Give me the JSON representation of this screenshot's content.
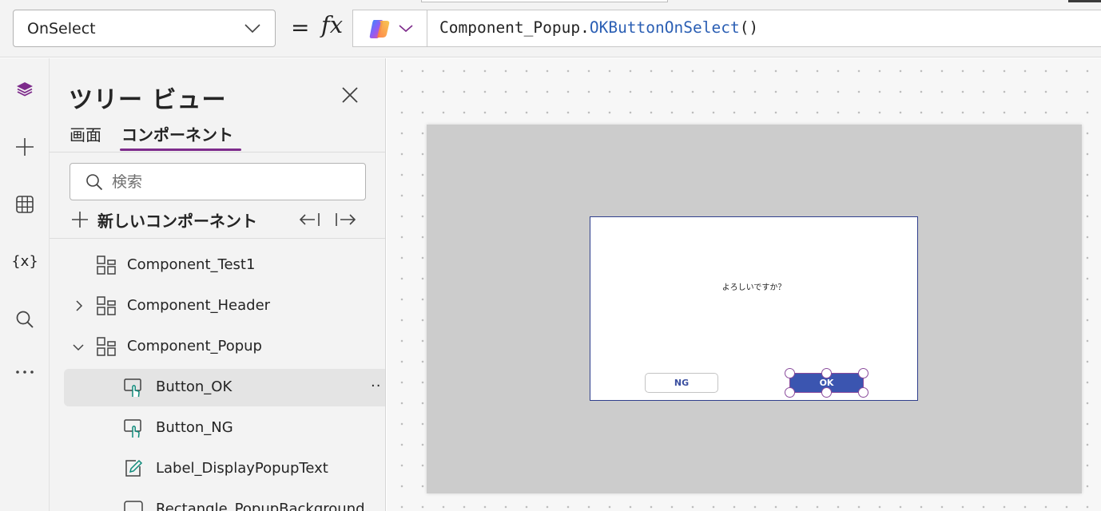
{
  "formula_bar": {
    "property": "OnSelect",
    "equals": "=",
    "fx": "fx",
    "formula_object": "Component_Popup.",
    "formula_function": "OKButtonOnSelect",
    "formula_args": "()"
  },
  "rail": {
    "items": [
      {
        "name": "layers-icon"
      },
      {
        "name": "plus-icon"
      },
      {
        "name": "table-icon"
      },
      {
        "name": "variables-icon",
        "text": "{x}"
      },
      {
        "name": "search-icon"
      },
      {
        "name": "more-icon",
        "text": "•••"
      }
    ],
    "accent": "#7d2b8b"
  },
  "tree": {
    "title": "ツリー ビュー",
    "tabs": [
      {
        "label": "画面"
      },
      {
        "label": "コンポーネント",
        "active": true
      }
    ],
    "search_placeholder": "検索",
    "new_component_label": "新しいコンポーネント",
    "items": [
      {
        "label": "Component_Test1",
        "icon": "component-icon",
        "chevron": "none"
      },
      {
        "label": "Component_Header",
        "icon": "component-icon",
        "chevron": "right"
      },
      {
        "label": "Component_Popup",
        "icon": "component-icon",
        "chevron": "down"
      },
      {
        "label": "Button_OK",
        "icon": "button-icon",
        "selected": true,
        "more": "··"
      },
      {
        "label": "Button_NG",
        "icon": "button-icon"
      },
      {
        "label": "Label_DisplayPopupText",
        "icon": "label-icon"
      },
      {
        "label": "Rectangle_PopupBackground",
        "icon": "rectangle-icon"
      }
    ]
  },
  "canvas": {
    "popup_text": "よろしいですか？",
    "ng_button": "NG",
    "ok_button": "OK",
    "ok_color": "#3b55b0",
    "selection_color": "#8a4b9c"
  }
}
